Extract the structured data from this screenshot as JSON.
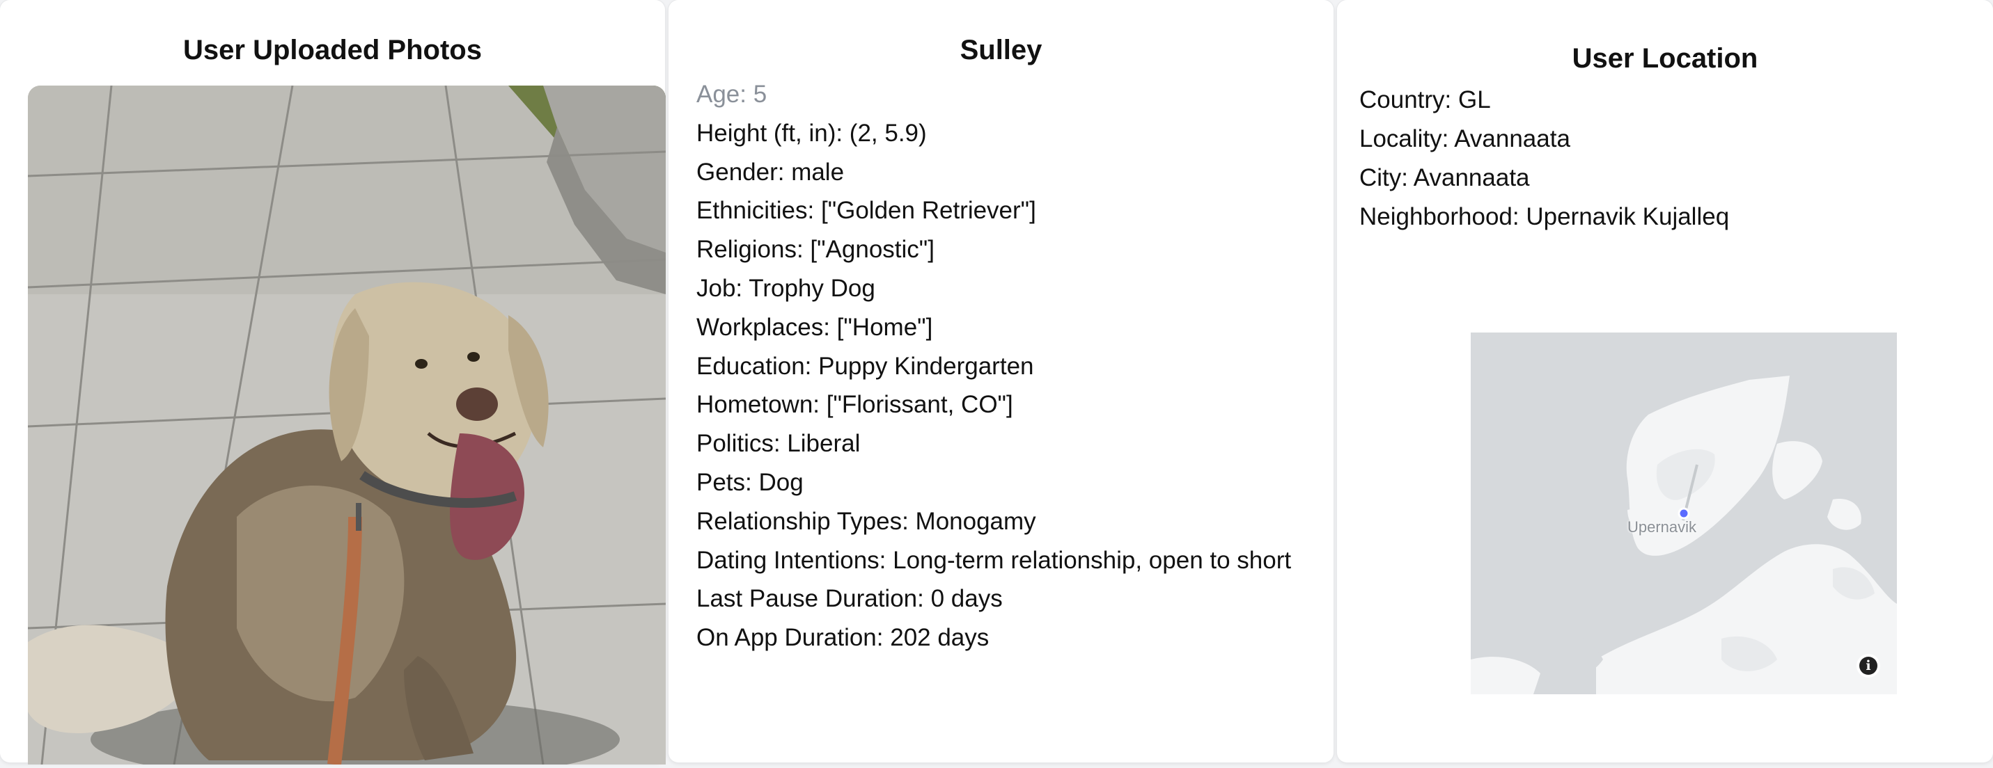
{
  "photos_panel": {
    "title": "User Uploaded Photos"
  },
  "profile": {
    "name": "Sulley",
    "fields": [
      "Age: 5",
      "Height (ft, in): (2, 5.9)",
      "Gender: male",
      "Ethnicities: [\"Golden Retriever\"]",
      "Religions: [\"Agnostic\"]",
      "Job: Trophy Dog",
      "Workplaces: [\"Home\"]",
      "Education: Puppy Kindergarten",
      "Hometown: [\"Florissant, CO\"]",
      "Politics: Liberal",
      "Pets: Dog",
      "Relationship Types: Monogamy",
      "Dating Intentions: Long-term relationship, open to short",
      "Last Pause Duration: 0 days",
      "On App Duration: 202 days"
    ]
  },
  "location": {
    "title": "User Location",
    "fields": [
      "Country: GL",
      "Locality: Avannaata",
      "City: Avannaata",
      "Neighborhood: Upernavik Kujalleq"
    ],
    "map": {
      "place_label": "Upernavik",
      "info_icon": "info-icon",
      "marker_color": "#5b6cff",
      "land_color": "#f4f5f6",
      "water_color": "#d6d9dc"
    }
  }
}
